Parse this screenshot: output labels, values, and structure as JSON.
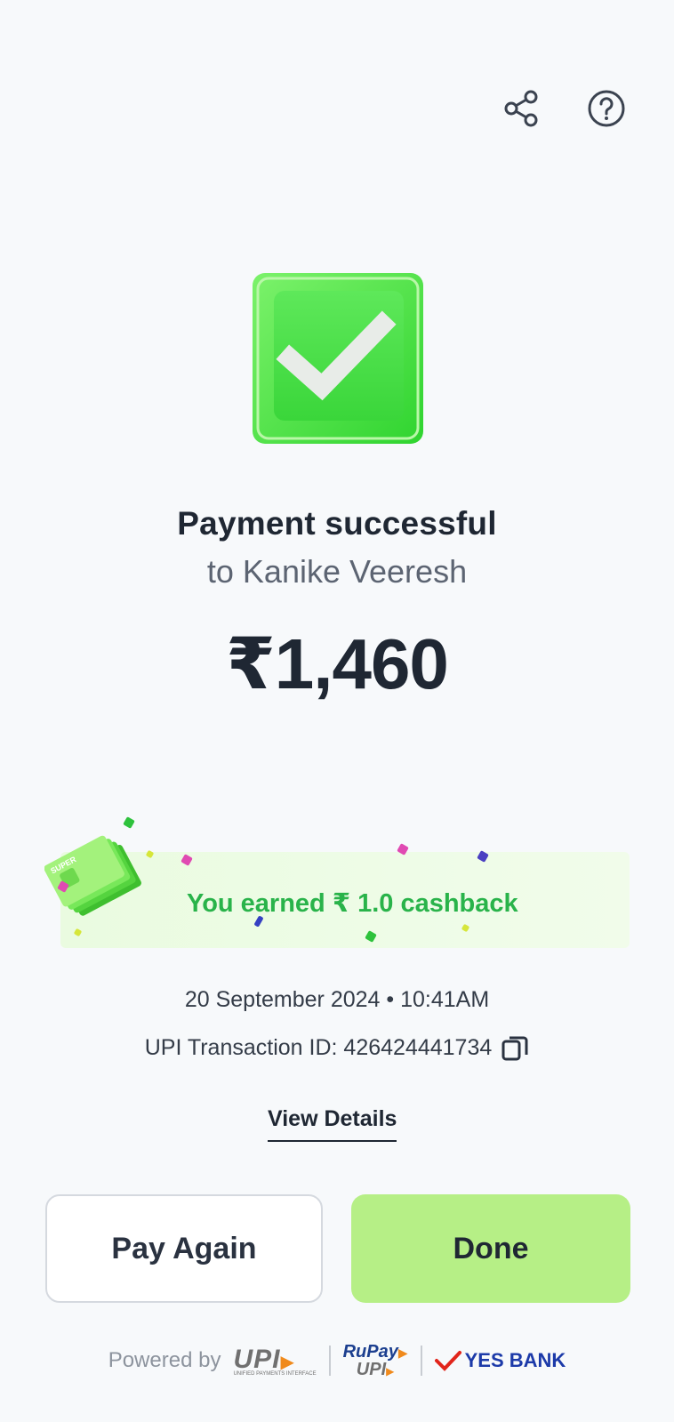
{
  "header": {
    "share_icon": "share-icon",
    "help_icon": "help-circle-icon"
  },
  "status": {
    "icon": "check-icon",
    "title": "Payment successful",
    "subtitle": "to Kanike Veeresh",
    "amount": "₹1,460"
  },
  "cashback": {
    "text": "You earned ₹ 1.0 cashback",
    "stack_label": "SUPER"
  },
  "transaction": {
    "datetime": "20 September 2024 • 10:41AM",
    "upi_id_label": "UPI Transaction ID: 426424441734",
    "copy_icon": "copy-icon"
  },
  "links": {
    "view_details": "View Details"
  },
  "actions": {
    "pay_again": "Pay Again",
    "done": "Done"
  },
  "footer": {
    "powered_by": "Powered by",
    "upi": "UPI",
    "upi_sub": "UNIFIED PAYMENTS INTERFACE",
    "rupay": "RuPay",
    "rupay_upi": "UPI",
    "bank": "YES BANK"
  },
  "colors": {
    "success_green": "#3be03b",
    "cashback_green": "#29b34a",
    "done_bg": "#b6ef86",
    "text_dark": "#1f2733"
  }
}
